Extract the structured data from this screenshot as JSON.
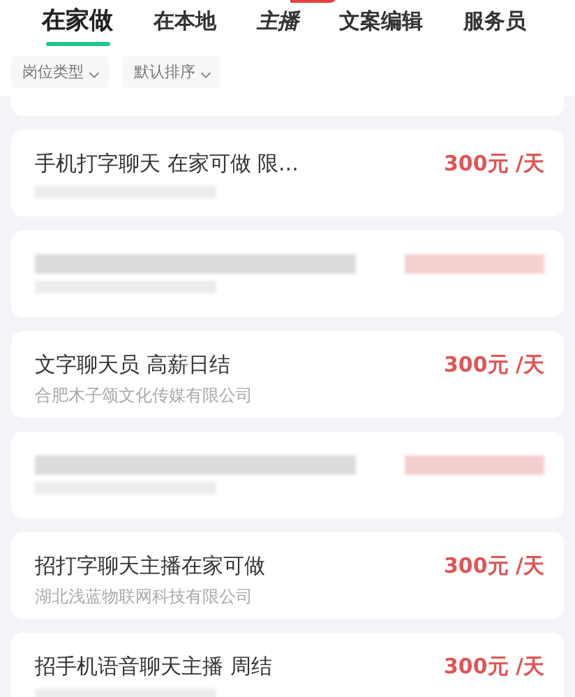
{
  "tabs": [
    {
      "label": "在家做",
      "selected": true,
      "italic": false,
      "badge": false
    },
    {
      "label": "在本地",
      "selected": false,
      "italic": false,
      "badge": false
    },
    {
      "label": "主播",
      "selected": false,
      "italic": true,
      "badge": true
    },
    {
      "label": "文案编辑",
      "selected": false,
      "italic": false,
      "badge": false
    },
    {
      "label": "服务员",
      "selected": false,
      "italic": false,
      "badge": false
    }
  ],
  "filters": [
    {
      "label": "岗位类型"
    },
    {
      "label": "默认排序"
    }
  ],
  "jobs": [
    {
      "title": "手机打字聊天 在家可做 限...",
      "price": "300元 /天",
      "blurred": false,
      "company_blurred": true
    },
    {
      "blurred": true
    },
    {
      "title": "文字聊天员 高薪日结",
      "price": "300元 /天",
      "company": "合肥木子颂文化传媒有限公司",
      "blurred": false,
      "company_blurred": false
    },
    {
      "blurred": true
    },
    {
      "title": "招打字聊天主播在家可做",
      "price": "300元 /天",
      "company": "湖北浅蓝物联网科技有限公司",
      "blurred": false,
      "company_blurred": false
    },
    {
      "title": "招手机语音聊天主播 周结",
      "price": "300元 /天",
      "blurred": false,
      "company_blurred": true
    }
  ]
}
